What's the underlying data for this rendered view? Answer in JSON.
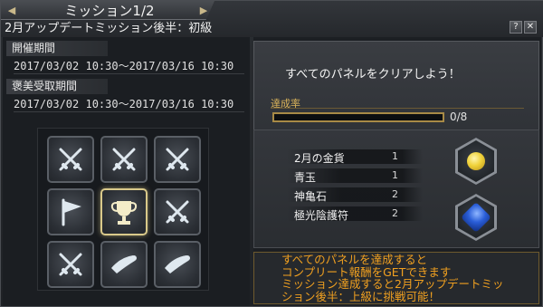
{
  "window": {
    "title": "ミッション1/2",
    "subtitle": "2月アップデートミッション後半：初級",
    "prev_arrow": "◀",
    "next_arrow": "▶",
    "help_btn": "?",
    "close_btn": "✕"
  },
  "left": {
    "period_label": "開催期間",
    "period_value": "2017/03/02 10:30～2017/03/16 10:30",
    "reward_period_label": "褒美受取期間",
    "reward_period_value": "2017/03/02 10:30～2017/03/16 10:30",
    "grid": [
      {
        "icon": "crossed-swords-icon",
        "active": false
      },
      {
        "icon": "crossed-swords-icon",
        "active": false
      },
      {
        "icon": "crossed-swords-icon",
        "active": false
      },
      {
        "icon": "flag-icon",
        "active": false
      },
      {
        "icon": "trophy-icon",
        "active": true
      },
      {
        "icon": "crossed-swords-icon",
        "active": false
      },
      {
        "icon": "crossed-swords-icon",
        "active": false
      },
      {
        "icon": "horn-icon",
        "active": false
      },
      {
        "icon": "horn-icon",
        "active": false
      }
    ]
  },
  "right": {
    "message": "すべてのパネルをクリアしよう！",
    "rate_label": "達成率",
    "progress": {
      "current": 0,
      "total": 8,
      "text": "0/8"
    },
    "rewards": [
      {
        "name": "2月の金貨",
        "qty": "1"
      },
      {
        "name": "青玉",
        "qty": "1"
      },
      {
        "name": "神亀石",
        "qty": "2"
      },
      {
        "name": "極光陰護符",
        "qty": "2"
      }
    ],
    "reward_icons": [
      "gold-coin-icon",
      "sapphire-gem-icon"
    ],
    "info_lines": [
      "すべてのパネルを達成すると",
      "コンプリート報酬をGETできます",
      "ミッション達成すると2月アップデートミッ",
      "ション後半：上級に挑戦可能！"
    ]
  },
  "colors": {
    "accent_gold": "#d9b25a",
    "info_text": "#f0a020",
    "active_border": "#d9c98a"
  }
}
